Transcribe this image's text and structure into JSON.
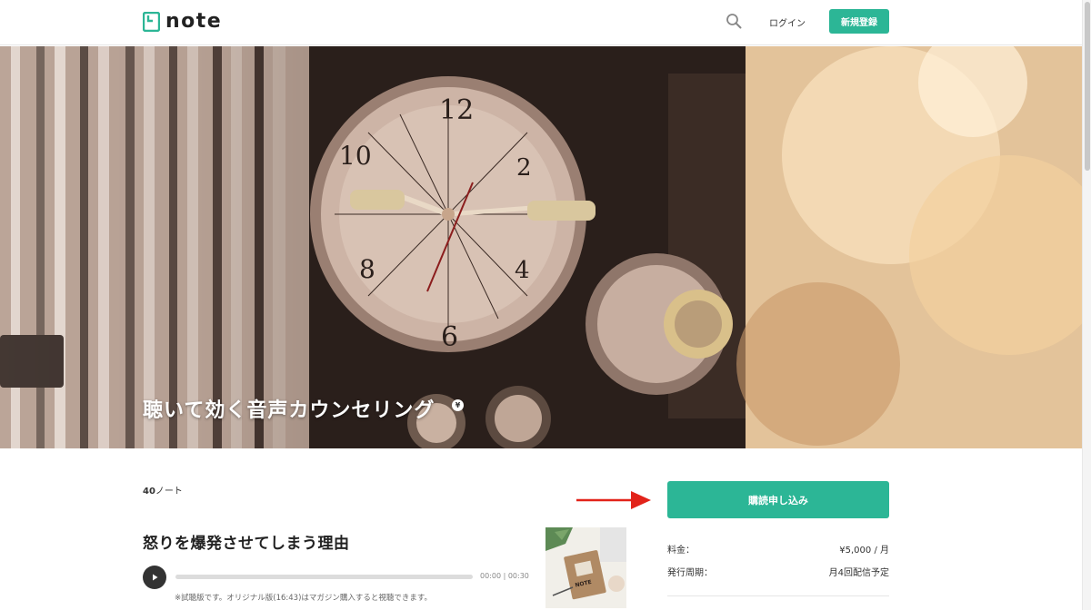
{
  "header": {
    "logo_text": "note",
    "login_label": "ログイン",
    "signup_label": "新規登録"
  },
  "hero": {
    "title": "聴いて効く音声カウンセリング",
    "badge": "¥"
  },
  "main": {
    "note_count_number": "40",
    "note_count_suffix": "ノート",
    "article": {
      "title": "怒りを爆発させてしまう理由",
      "audio": {
        "current_time": "00:00",
        "duration": "00:30",
        "progress": 0,
        "trial_note": "※試聴版です。オリジナル版(16:43)はマガジン購入すると視聴できます。"
      },
      "thumbnail_text": "NOTE"
    }
  },
  "sidebar": {
    "subscribe_label": "購読申し込み",
    "price_label": "料金：",
    "price_value": "¥5,000 / 月",
    "cycle_label": "発行周期：",
    "cycle_value": "月4回配信予定"
  },
  "colors": {
    "brand_green": "#2cb696",
    "arrow_red": "#e2231a"
  }
}
